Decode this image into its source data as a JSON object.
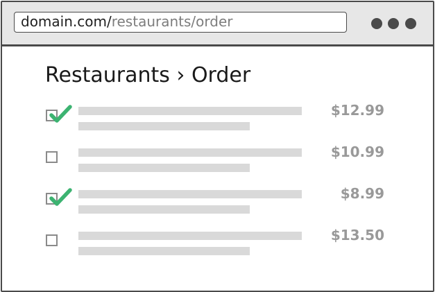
{
  "browser": {
    "url_domain": "domain.com/",
    "url_path": "restaurants/order"
  },
  "page": {
    "title": "Restaurants › Order"
  },
  "colors": {
    "check_green": "#3cb371",
    "price_gray": "#999999",
    "placeholder_gray": "#d9d9d9",
    "frame_dark": "#4a4a4a"
  },
  "order_items": [
    {
      "checked": true,
      "price": "$12.99"
    },
    {
      "checked": false,
      "price": "$10.99"
    },
    {
      "checked": true,
      "price": "$8.99"
    },
    {
      "checked": false,
      "price": "$13.50"
    }
  ]
}
